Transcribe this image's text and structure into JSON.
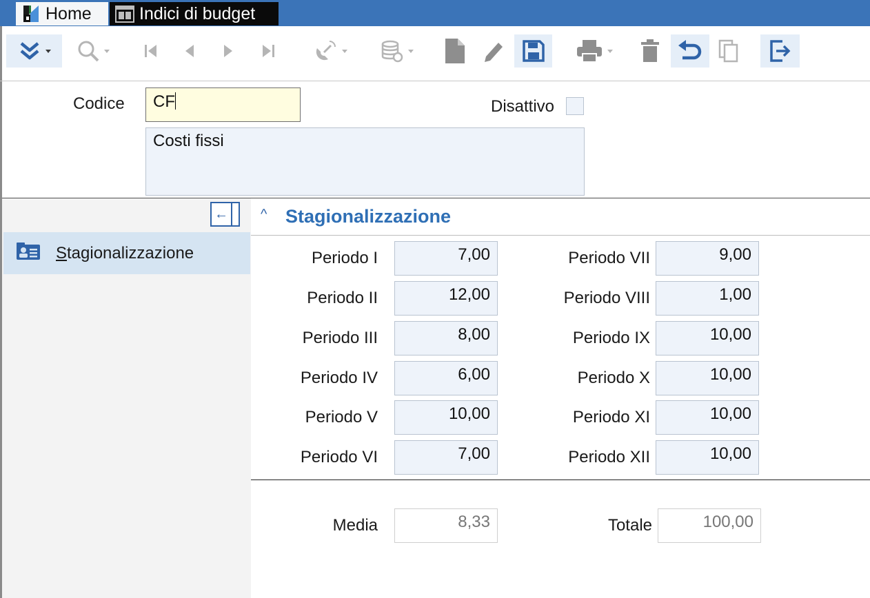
{
  "tabs": {
    "home": "Home",
    "active": "Indici di budget"
  },
  "toolbar": {
    "buttons": [
      "expand-menu",
      "search",
      "first",
      "previous",
      "next",
      "last",
      "connect",
      "database",
      "new",
      "edit",
      "save",
      "print",
      "delete",
      "undo",
      "copy",
      "exit"
    ]
  },
  "header": {
    "codice_label": "Codice",
    "codice_value": "CF",
    "description": "Costi fissi",
    "disattivo_label": "Disattivo",
    "disattivo_checked": false
  },
  "sidebar": {
    "item_label_first": "S",
    "item_label_rest": "tagionalizzazione"
  },
  "section": {
    "title": "Stagionalizzazione",
    "periods": [
      {
        "label": "Periodo I",
        "value": "7,00"
      },
      {
        "label": "Periodo II",
        "value": "12,00"
      },
      {
        "label": "Periodo III",
        "value": "8,00"
      },
      {
        "label": "Periodo IV",
        "value": "6,00"
      },
      {
        "label": "Periodo V",
        "value": "10,00"
      },
      {
        "label": "Periodo VI",
        "value": "7,00"
      },
      {
        "label": "Periodo VII",
        "value": "9,00"
      },
      {
        "label": "Periodo VIII",
        "value": "1,00"
      },
      {
        "label": "Periodo IX",
        "value": "10,00"
      },
      {
        "label": "Periodo X",
        "value": "10,00"
      },
      {
        "label": "Periodo XI",
        "value": "10,00"
      },
      {
        "label": "Periodo XII",
        "value": "10,00"
      }
    ],
    "media_label": "Media",
    "media_value": "8,33",
    "totale_label": "Totale",
    "totale_value": "100,00"
  },
  "colors": {
    "tabbar": "#3b74b8",
    "accent": "#2f6fb5",
    "required_field": "#fffde0",
    "field_bg": "#eef3fa",
    "sidebar_selected": "#d5e4f2"
  }
}
